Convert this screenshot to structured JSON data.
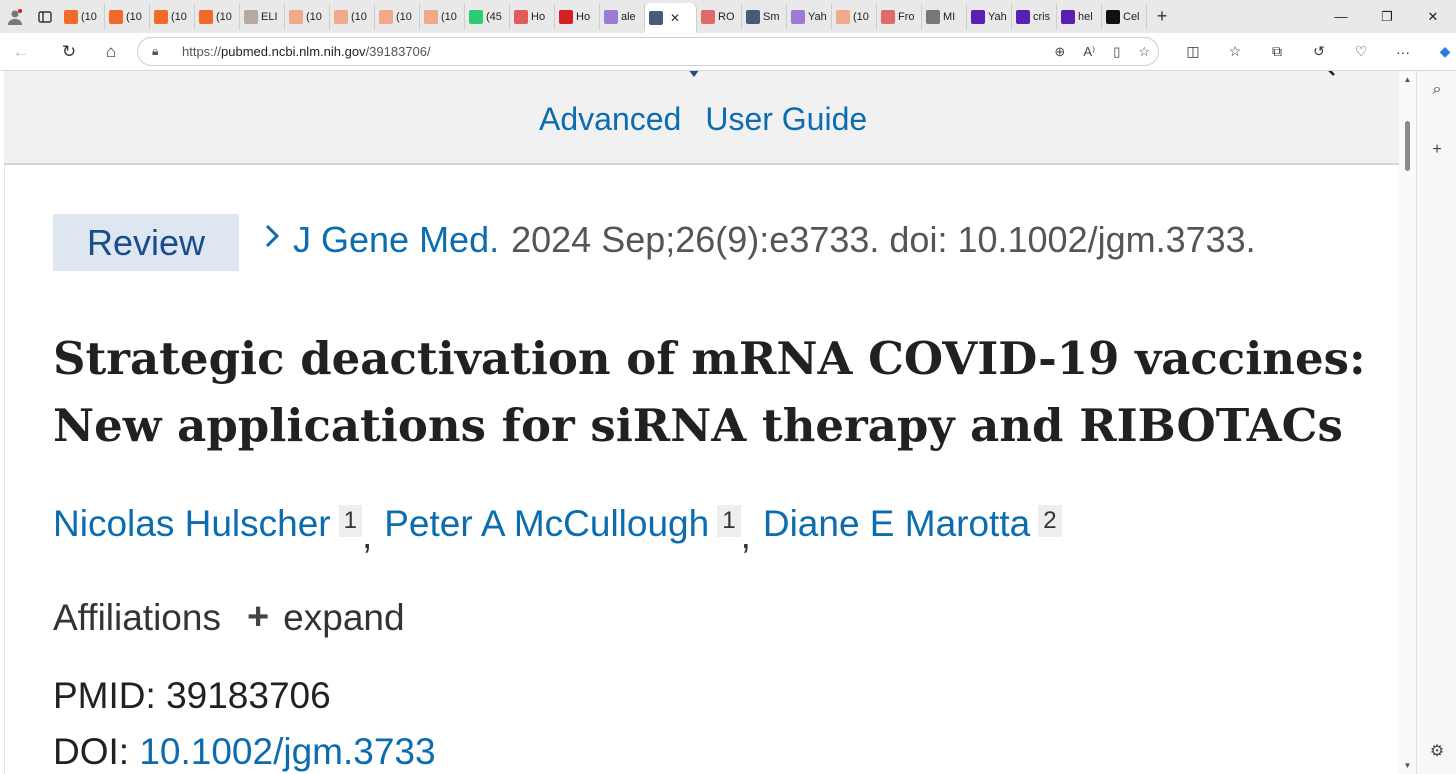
{
  "browser": {
    "tabs": [
      {
        "label": "(10",
        "color": "#f06a2a",
        "icon": "substack-icon"
      },
      {
        "label": "(10",
        "color": "#f06a2a",
        "icon": "substack-icon"
      },
      {
        "label": "(10",
        "color": "#f06a2a",
        "icon": "substack-icon"
      },
      {
        "label": "(10",
        "color": "#f06a2a",
        "icon": "substack-icon"
      },
      {
        "label": "ELI",
        "color": "#b7a9a0",
        "icon": "eye-icon"
      },
      {
        "label": "(10",
        "color": "#f0a98a",
        "icon": "substack-icon"
      },
      {
        "label": "(10",
        "color": "#f0a98a",
        "icon": "substack-icon"
      },
      {
        "label": "(10",
        "color": "#f0a98a",
        "icon": "substack-icon"
      },
      {
        "label": "(10",
        "color": "#f0a98a",
        "icon": "substack-icon"
      },
      {
        "label": "(45",
        "color": "#2ecc71",
        "icon": "g-icon"
      },
      {
        "label": "Ho",
        "color": "#e25a5a",
        "icon": "mic-icon"
      },
      {
        "label": "Ho",
        "color": "#d32020",
        "icon": "video-icon"
      },
      {
        "label": "ale",
        "color": "#9b7bd4",
        "icon": "yahoo-icon"
      },
      {
        "label": "",
        "color": "#4a5a7a",
        "icon": "rumble-icon",
        "active": true
      },
      {
        "label": "RO",
        "color": "#e06a6a",
        "icon": "youtube-icon"
      },
      {
        "label": "Sm",
        "color": "#4a5a7a",
        "icon": "rumble-icon"
      },
      {
        "label": "Yah",
        "color": "#9b7bd4",
        "icon": "yahoo-icon"
      },
      {
        "label": "(10",
        "color": "#f0a98a",
        "icon": "substack-icon"
      },
      {
        "label": "Fro",
        "color": "#e06a6a",
        "icon": "youtube-icon"
      },
      {
        "label": "MI",
        "color": "#777777",
        "icon": "x-icon"
      },
      {
        "label": "Yah",
        "color": "#5a1fb3",
        "icon": "yahoo-icon"
      },
      {
        "label": "cris",
        "color": "#5a1fb3",
        "icon": "yahoo-icon"
      },
      {
        "label": "hel",
        "color": "#5a1fb3",
        "icon": "yahoo-icon"
      },
      {
        "label": "Cel",
        "color": "#111111",
        "icon": "n-icon"
      }
    ],
    "url_prefix": "https://",
    "url_host": "pubmed.ncbi.nlm.nih.gov",
    "url_path": "/39183706/"
  },
  "header": {
    "links": [
      "Advanced",
      "User Guide"
    ]
  },
  "article": {
    "badge": "Review",
    "journal": "J Gene Med.",
    "citation": "2024 Sep;26(9):e3733. doi: 10.1002/jgm.3733.",
    "title_line1": "Strategic deactivation of mRNA COVID-19 vaccines:",
    "title_line2": "New applications for siRNA therapy and RIBOTACs",
    "authors": [
      {
        "name": "Nicolas Hulscher",
        "aff": "1"
      },
      {
        "name": "Peter A McCullough",
        "aff": "1"
      },
      {
        "name": "Diane E Marotta",
        "aff": "2"
      }
    ],
    "affiliations_label": "Affiliations",
    "expand_label": "expand",
    "pmid_label": "PMID:",
    "pmid": "39183706",
    "doi_label": "DOI:",
    "doi": "10.1002/jgm.3733"
  },
  "colors": {
    "link": "#0b6cb0",
    "badge_bg": "#dde6f1",
    "badge_text": "#1a4d8c"
  }
}
